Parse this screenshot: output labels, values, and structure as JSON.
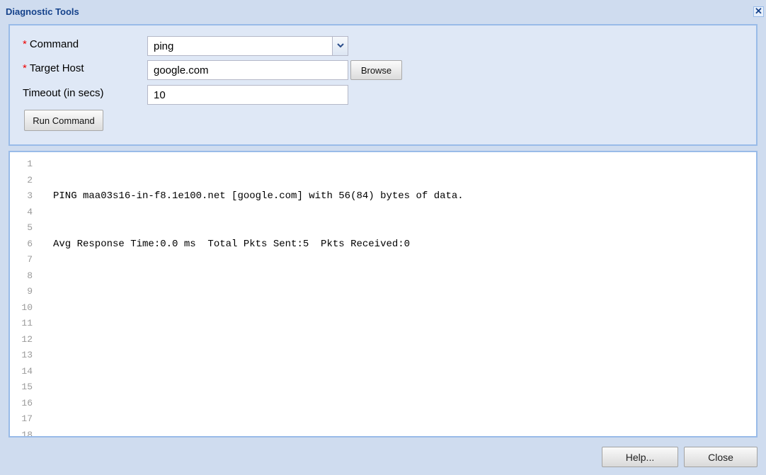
{
  "window": {
    "title": "Diagnostic Tools",
    "close_glyph": "✕"
  },
  "form": {
    "required_marker": "*",
    "command": {
      "label": "Command",
      "value": "ping",
      "required": true
    },
    "target_host": {
      "label": "Target Host",
      "value": "google.com",
      "required": true
    },
    "timeout": {
      "label": "Timeout (in secs)",
      "value": "10",
      "required": false
    },
    "browse_label": "Browse",
    "run_label": "Run Command"
  },
  "output": {
    "lines": [
      {
        "n": "1",
        "text": ""
      },
      {
        "n": "2",
        "text": ""
      },
      {
        "n": "3",
        "text": "PING maa03s16-in-f8.1e100.net [google.com] with 56(84) bytes of data."
      },
      {
        "n": "4",
        "text": ""
      },
      {
        "n": "5",
        "text": ""
      },
      {
        "n": "6",
        "text": "Avg Response Time:0.0 ms  Total Pkts Sent:5  Pkts Received:0"
      },
      {
        "n": "7",
        "text": ""
      },
      {
        "n": "8",
        "text": ""
      },
      {
        "n": "9",
        "text": ""
      },
      {
        "n": "10",
        "text": ""
      },
      {
        "n": "11",
        "text": ""
      },
      {
        "n": "12",
        "text": ""
      },
      {
        "n": "13",
        "text": ""
      },
      {
        "n": "14",
        "text": ""
      },
      {
        "n": "15",
        "text": ""
      },
      {
        "n": "16",
        "text": ""
      },
      {
        "n": "17",
        "text": ""
      },
      {
        "n": "18",
        "text": ""
      }
    ]
  },
  "footer": {
    "help_label": "Help...",
    "close_label": "Close"
  },
  "colors": {
    "window_bg": "#cfdcef",
    "panel_bg": "#dfe8f6",
    "border": "#99bbe8",
    "title_text": "#15428b",
    "required": "#ee0000"
  },
  "icons": {
    "close": "close-icon",
    "dropdown": "chevron-down-icon"
  }
}
